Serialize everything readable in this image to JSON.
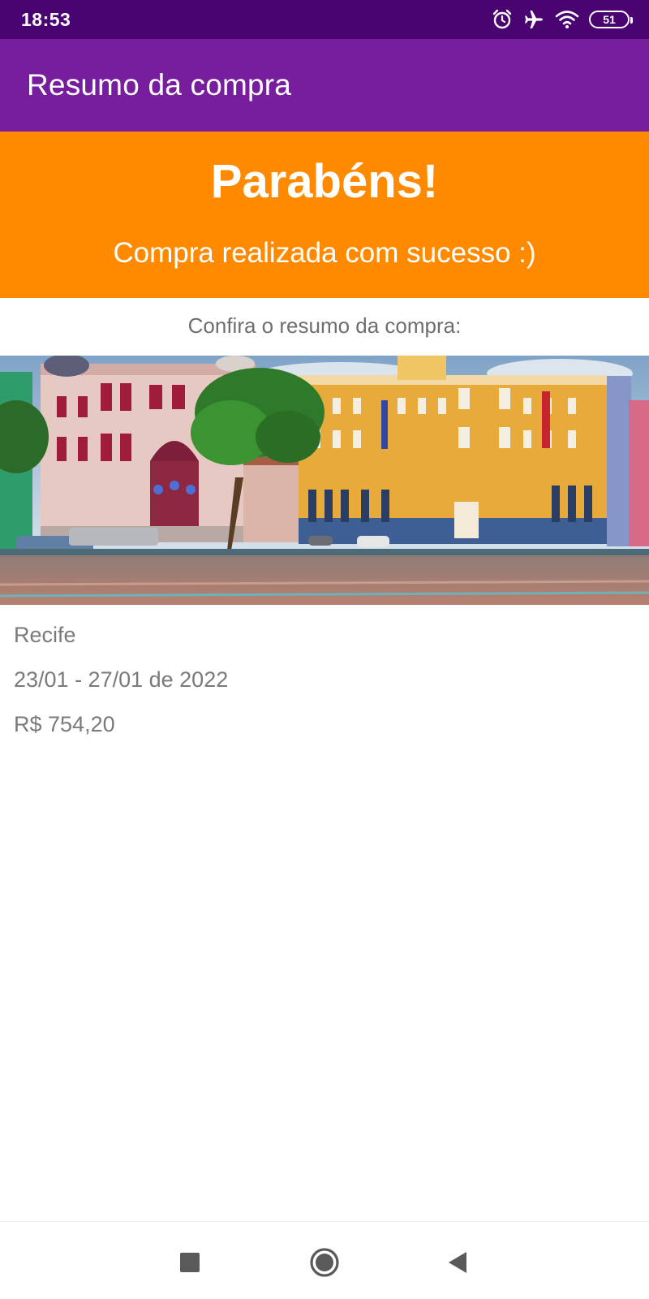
{
  "status_bar": {
    "time": "18:53",
    "battery": "51",
    "icons": [
      "alarm-icon",
      "airplane-mode-icon",
      "wifi-icon",
      "battery-icon"
    ]
  },
  "app_bar": {
    "title": "Resumo da compra"
  },
  "banner": {
    "title": "Parabéns!",
    "subtitle": "Compra realizada com sucesso :)"
  },
  "summary": {
    "label": "Confira o resumo da compra:",
    "city": "Recife",
    "dates": "23/01 - 27/01 de 2022",
    "price": "R$ 754,20"
  },
  "nav_bar": {
    "icons": [
      "recents-square-icon",
      "home-circle-icon",
      "back-triangle-icon"
    ]
  },
  "colors": {
    "status_bar": "#4a0472",
    "app_bar": "#761e9e",
    "banner": "#ff8a00",
    "text_gray": "#7a7a7a"
  }
}
